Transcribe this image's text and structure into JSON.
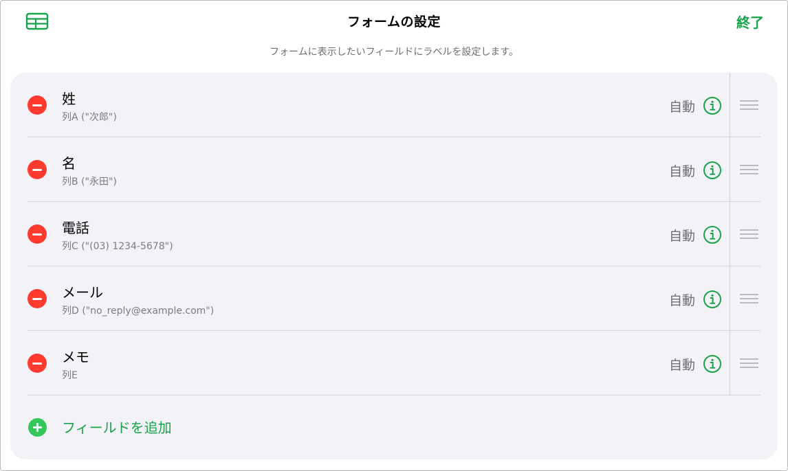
{
  "header": {
    "title": "フォームの設定",
    "done_label": "終了",
    "subtitle": "フォームに表示したいフィールドにラベルを設定します。",
    "table_icon": "table-icon"
  },
  "fields": [
    {
      "name": "姓",
      "source": "列A (\"次郎\")",
      "type": "自動"
    },
    {
      "name": "名",
      "source": "列B (\"永田\")",
      "type": "自動"
    },
    {
      "name": "電話",
      "source": "列C (\"(03) 1234-5678\")",
      "type": "自動"
    },
    {
      "name": "メール",
      "source": "列D (\"no_reply@example.com\")",
      "type": "自動"
    },
    {
      "name": "メモ",
      "source": "列E",
      "type": "自動"
    }
  ],
  "add_field_label": "フィールドを追加",
  "icons": {
    "remove": "minus-circle-icon",
    "info": "info-circle-icon",
    "drag": "drag-handle-icon",
    "add": "plus-circle-icon"
  },
  "colors": {
    "accent_green": "#17a34a",
    "remove_red": "#ff3b30",
    "add_green": "#34c759",
    "card_bg": "#f2f2f7",
    "secondary_text": "#6e6e73"
  }
}
